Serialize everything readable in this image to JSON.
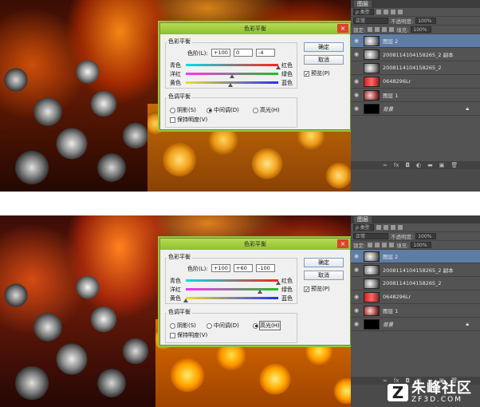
{
  "top": {
    "dialog": {
      "title": "色彩平衡",
      "close_label": "×",
      "balance_group": "色彩平衡",
      "levels_label": "色阶(L):",
      "levels": [
        "+100",
        "0",
        "-4"
      ],
      "sliders": [
        {
          "left": "青色",
          "right": "红色",
          "value": 100
        },
        {
          "left": "洋红",
          "right": "绿色",
          "value": 0
        },
        {
          "left": "黄色",
          "right": "蓝色",
          "value": -4
        }
      ],
      "tone_group": "色调平衡",
      "tones": [
        {
          "label": "阴影(S)",
          "checked": false
        },
        {
          "label": "中间调(D)",
          "checked": true
        },
        {
          "label": "高光(H)",
          "checked": false
        }
      ],
      "preserve_label": "保持明度(V)",
      "preserve_checked": false,
      "ok_label": "确定",
      "cancel_label": "取消",
      "preview_label": "预览(P)",
      "preview_checked": true
    },
    "layers": {
      "tab_label": "图层",
      "kind_label": "ρ 类型",
      "mode": "正常",
      "opacity_label": "不透明度:",
      "opacity": "100%",
      "lock_label": "锁定:",
      "fill_label": "填充:",
      "fill": "100%",
      "items": [
        {
          "name": "图层 2",
          "thumb": "rose",
          "selected": true,
          "visible": true
        },
        {
          "name": "2008114104158265_2 副本",
          "thumb": "rose",
          "selected": false,
          "visible": true
        },
        {
          "name": "2008114104158265_2",
          "thumb": "rose",
          "selected": false,
          "visible": false
        },
        {
          "name": "0648296Lr",
          "thumb": "red",
          "selected": false,
          "visible": true
        },
        {
          "name": "图层 1",
          "thumb": "rose2",
          "selected": false,
          "visible": true
        },
        {
          "name": "背景",
          "thumb": "black",
          "selected": false,
          "visible": true
        }
      ],
      "footer_icons": [
        "link-icon",
        "fx-icon",
        "mask-icon",
        "adjustment-icon",
        "folder-icon",
        "new-layer-icon",
        "trash-icon"
      ]
    }
  },
  "bottom": {
    "dialog": {
      "title": "色彩平衡",
      "close_label": "×",
      "balance_group": "色彩平衡",
      "levels_label": "色阶(L):",
      "levels": [
        "+100",
        "+60",
        "-100"
      ],
      "sliders": [
        {
          "left": "青色",
          "right": "红色",
          "value": 100
        },
        {
          "left": "洋红",
          "right": "绿色",
          "value": 60
        },
        {
          "left": "黄色",
          "right": "蓝色",
          "value": -100
        }
      ],
      "tone_group": "色调平衡",
      "tones": [
        {
          "label": "阴影(S)",
          "checked": false
        },
        {
          "label": "中间调(D)",
          "checked": false
        },
        {
          "label": "高光(H)",
          "checked": true
        }
      ],
      "preserve_label": "保持明度(V)",
      "preserve_checked": false,
      "ok_label": "确定",
      "cancel_label": "取消",
      "preview_label": "预览(P)",
      "preview_checked": true
    },
    "layers": {
      "tab_label": "图层",
      "kind_label": "ρ 类型",
      "mode": "正常",
      "opacity_label": "不透明度:",
      "opacity": "100%",
      "lock_label": "锁定:",
      "fill_label": "填充:",
      "fill": "100%",
      "items": [
        {
          "name": "图层 2",
          "thumb": "rose",
          "selected": true,
          "visible": true
        },
        {
          "name": "2008114104158265_2 副本",
          "thumb": "rose",
          "selected": false,
          "visible": true
        },
        {
          "name": "2008114104158265_2",
          "thumb": "rose",
          "selected": false,
          "visible": false
        },
        {
          "name": "0648296Lr",
          "thumb": "red",
          "selected": false,
          "visible": true
        },
        {
          "name": "图层 1",
          "thumb": "rose2",
          "selected": false,
          "visible": true
        },
        {
          "name": "背景",
          "thumb": "black",
          "selected": false,
          "visible": true
        }
      ]
    }
  },
  "watermark": {
    "brand": "朱峰社区",
    "url": "ZF3D.COM",
    "logo": "Z"
  }
}
